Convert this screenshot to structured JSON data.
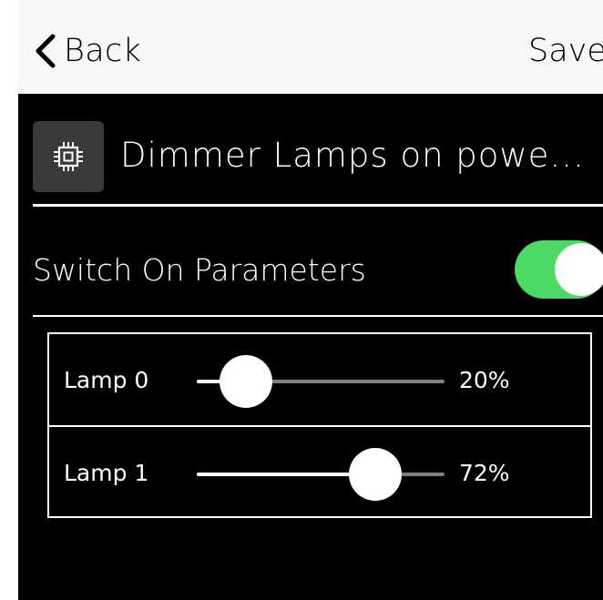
{
  "nav": {
    "back_label": "Back",
    "save_label": "Save"
  },
  "device": {
    "icon": "chip-icon",
    "title": "Dimmer Lamps on powe..."
  },
  "switch_on": {
    "label": "Switch On Parameters",
    "enabled": true,
    "color": "#4cd964"
  },
  "lamps": [
    {
      "label": "Lamp 0",
      "value_text": "20%",
      "value": 0.2
    },
    {
      "label": "Lamp 1",
      "value_text": "72%",
      "value": 0.72
    }
  ]
}
